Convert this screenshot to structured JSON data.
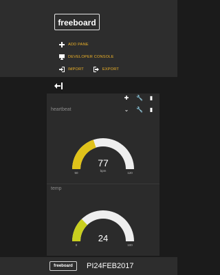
{
  "header": {
    "logo_text": "freeboard",
    "menu": {
      "add_pane": "ADD PANE",
      "developer_console": "DEVELOPER CONSOLE",
      "import": "IMPORT",
      "export": "EXPORT"
    }
  },
  "dashboard": {
    "widgets": [
      {
        "title": "heartbeat",
        "value": "77",
        "units": "bpm",
        "min": "50",
        "max": "120"
      },
      {
        "title": "temp",
        "value": "24",
        "units": "",
        "min": "0",
        "max": "100"
      }
    ]
  },
  "footer": {
    "logo_text": "freeboard",
    "label": "PI24FEB2017"
  },
  "colors": {
    "accent": "#f0b429",
    "gauge_fill_1": "#e0c21a",
    "gauge_fill_2": "#c9cf1f",
    "gauge_track": "#eeeeee"
  }
}
